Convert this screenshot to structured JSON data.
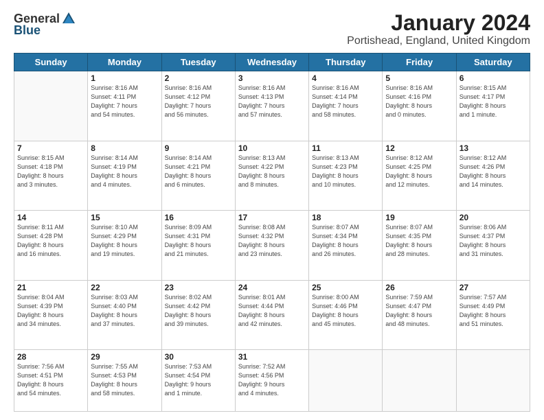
{
  "logo": {
    "general": "General",
    "blue": "Blue"
  },
  "header": {
    "title": "January 2024",
    "subtitle": "Portishead, England, United Kingdom"
  },
  "days_of_week": [
    "Sunday",
    "Monday",
    "Tuesday",
    "Wednesday",
    "Thursday",
    "Friday",
    "Saturday"
  ],
  "weeks": [
    [
      {
        "day": "",
        "info": ""
      },
      {
        "day": "1",
        "info": "Sunrise: 8:16 AM\nSunset: 4:11 PM\nDaylight: 7 hours\nand 54 minutes."
      },
      {
        "day": "2",
        "info": "Sunrise: 8:16 AM\nSunset: 4:12 PM\nDaylight: 7 hours\nand 56 minutes."
      },
      {
        "day": "3",
        "info": "Sunrise: 8:16 AM\nSunset: 4:13 PM\nDaylight: 7 hours\nand 57 minutes."
      },
      {
        "day": "4",
        "info": "Sunrise: 8:16 AM\nSunset: 4:14 PM\nDaylight: 7 hours\nand 58 minutes."
      },
      {
        "day": "5",
        "info": "Sunrise: 8:16 AM\nSunset: 4:16 PM\nDaylight: 8 hours\nand 0 minutes."
      },
      {
        "day": "6",
        "info": "Sunrise: 8:15 AM\nSunset: 4:17 PM\nDaylight: 8 hours\nand 1 minute."
      }
    ],
    [
      {
        "day": "7",
        "info": "Sunrise: 8:15 AM\nSunset: 4:18 PM\nDaylight: 8 hours\nand 3 minutes."
      },
      {
        "day": "8",
        "info": "Sunrise: 8:14 AM\nSunset: 4:19 PM\nDaylight: 8 hours\nand 4 minutes."
      },
      {
        "day": "9",
        "info": "Sunrise: 8:14 AM\nSunset: 4:21 PM\nDaylight: 8 hours\nand 6 minutes."
      },
      {
        "day": "10",
        "info": "Sunrise: 8:13 AM\nSunset: 4:22 PM\nDaylight: 8 hours\nand 8 minutes."
      },
      {
        "day": "11",
        "info": "Sunrise: 8:13 AM\nSunset: 4:23 PM\nDaylight: 8 hours\nand 10 minutes."
      },
      {
        "day": "12",
        "info": "Sunrise: 8:12 AM\nSunset: 4:25 PM\nDaylight: 8 hours\nand 12 minutes."
      },
      {
        "day": "13",
        "info": "Sunrise: 8:12 AM\nSunset: 4:26 PM\nDaylight: 8 hours\nand 14 minutes."
      }
    ],
    [
      {
        "day": "14",
        "info": "Sunrise: 8:11 AM\nSunset: 4:28 PM\nDaylight: 8 hours\nand 16 minutes."
      },
      {
        "day": "15",
        "info": "Sunrise: 8:10 AM\nSunset: 4:29 PM\nDaylight: 8 hours\nand 19 minutes."
      },
      {
        "day": "16",
        "info": "Sunrise: 8:09 AM\nSunset: 4:31 PM\nDaylight: 8 hours\nand 21 minutes."
      },
      {
        "day": "17",
        "info": "Sunrise: 8:08 AM\nSunset: 4:32 PM\nDaylight: 8 hours\nand 23 minutes."
      },
      {
        "day": "18",
        "info": "Sunrise: 8:07 AM\nSunset: 4:34 PM\nDaylight: 8 hours\nand 26 minutes."
      },
      {
        "day": "19",
        "info": "Sunrise: 8:07 AM\nSunset: 4:35 PM\nDaylight: 8 hours\nand 28 minutes."
      },
      {
        "day": "20",
        "info": "Sunrise: 8:06 AM\nSunset: 4:37 PM\nDaylight: 8 hours\nand 31 minutes."
      }
    ],
    [
      {
        "day": "21",
        "info": "Sunrise: 8:04 AM\nSunset: 4:39 PM\nDaylight: 8 hours\nand 34 minutes."
      },
      {
        "day": "22",
        "info": "Sunrise: 8:03 AM\nSunset: 4:40 PM\nDaylight: 8 hours\nand 37 minutes."
      },
      {
        "day": "23",
        "info": "Sunrise: 8:02 AM\nSunset: 4:42 PM\nDaylight: 8 hours\nand 39 minutes."
      },
      {
        "day": "24",
        "info": "Sunrise: 8:01 AM\nSunset: 4:44 PM\nDaylight: 8 hours\nand 42 minutes."
      },
      {
        "day": "25",
        "info": "Sunrise: 8:00 AM\nSunset: 4:46 PM\nDaylight: 8 hours\nand 45 minutes."
      },
      {
        "day": "26",
        "info": "Sunrise: 7:59 AM\nSunset: 4:47 PM\nDaylight: 8 hours\nand 48 minutes."
      },
      {
        "day": "27",
        "info": "Sunrise: 7:57 AM\nSunset: 4:49 PM\nDaylight: 8 hours\nand 51 minutes."
      }
    ],
    [
      {
        "day": "28",
        "info": "Sunrise: 7:56 AM\nSunset: 4:51 PM\nDaylight: 8 hours\nand 54 minutes."
      },
      {
        "day": "29",
        "info": "Sunrise: 7:55 AM\nSunset: 4:53 PM\nDaylight: 8 hours\nand 58 minutes."
      },
      {
        "day": "30",
        "info": "Sunrise: 7:53 AM\nSunset: 4:54 PM\nDaylight: 9 hours\nand 1 minute."
      },
      {
        "day": "31",
        "info": "Sunrise: 7:52 AM\nSunset: 4:56 PM\nDaylight: 9 hours\nand 4 minutes."
      },
      {
        "day": "",
        "info": ""
      },
      {
        "day": "",
        "info": ""
      },
      {
        "day": "",
        "info": ""
      }
    ]
  ]
}
